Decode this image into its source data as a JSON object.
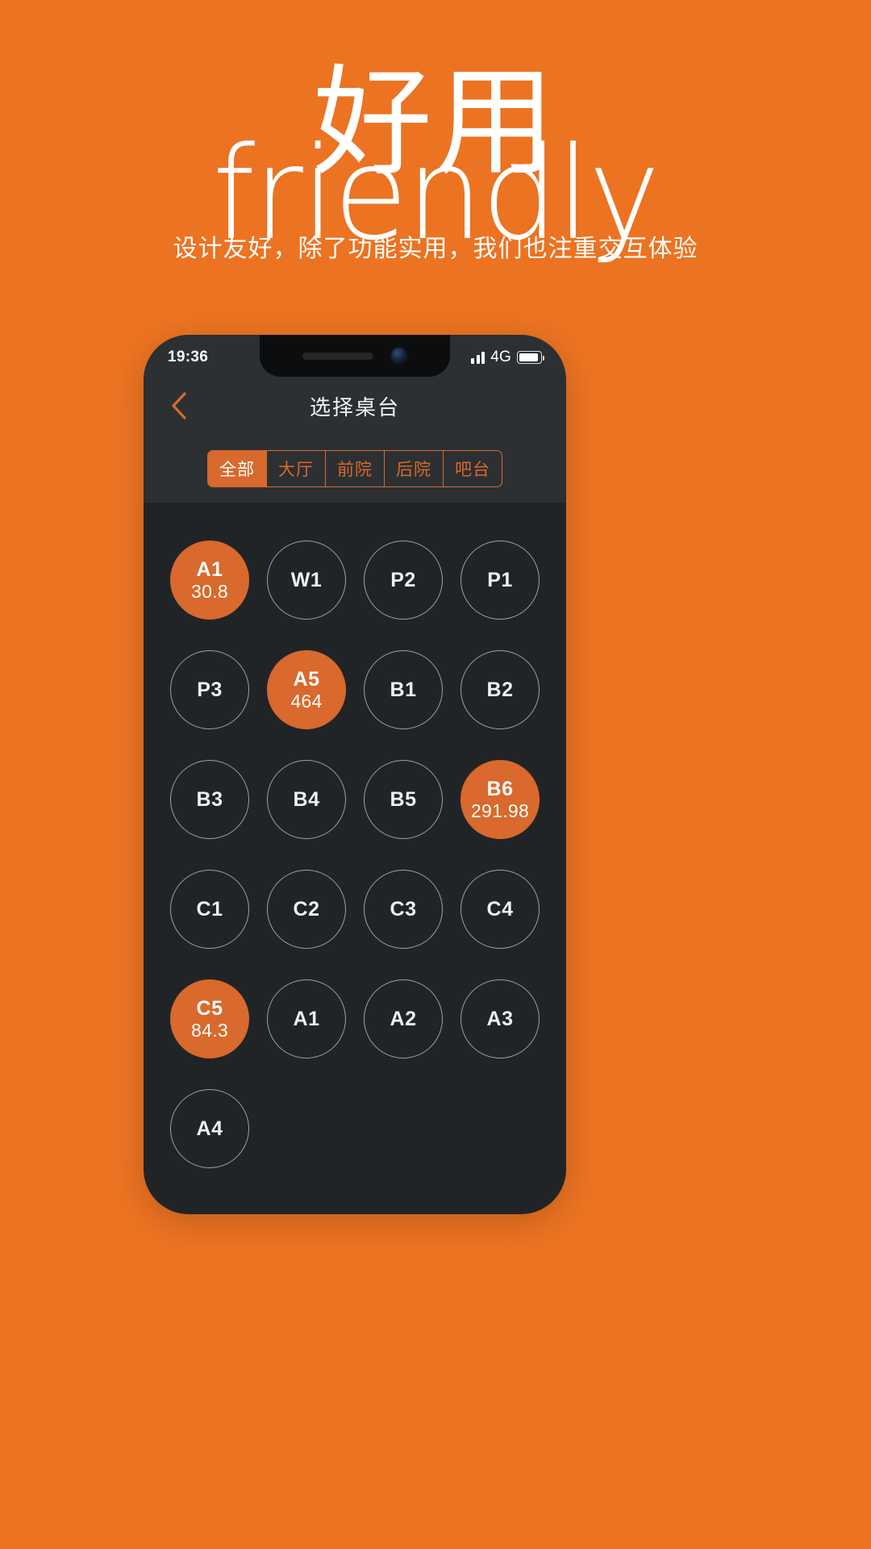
{
  "hero": {
    "headline_cn": "好用",
    "headline_en": "friendly",
    "subtitle": "设计友好，除了功能实用，我们也注重交互体验"
  },
  "colors": {
    "background": "#EC7322",
    "accent": "#D9692C",
    "phone_body": "#2C3033",
    "screen": "#212427",
    "outline": "#9BA0A3"
  },
  "phone": {
    "status_bar": {
      "time": "19:36",
      "network": "4G",
      "signal_icon": "signal-bars-icon",
      "battery_icon": "battery-icon"
    },
    "nav": {
      "back_icon": "chevron-left-icon",
      "title": "选择桌台"
    },
    "tabs": [
      {
        "label": "全部",
        "active": true
      },
      {
        "label": "大厅",
        "active": false
      },
      {
        "label": "前院",
        "active": false
      },
      {
        "label": "后院",
        "active": false
      },
      {
        "label": "吧台",
        "active": false
      }
    ],
    "tables": [
      {
        "name": "A1",
        "amount": "30.8",
        "status": "busy"
      },
      {
        "name": "W1",
        "amount": "",
        "status": "free"
      },
      {
        "name": "P2",
        "amount": "",
        "status": "free"
      },
      {
        "name": "P1",
        "amount": "",
        "status": "free"
      },
      {
        "name": "P3",
        "amount": "",
        "status": "free"
      },
      {
        "name": "A5",
        "amount": "464",
        "status": "busy"
      },
      {
        "name": "B1",
        "amount": "",
        "status": "free"
      },
      {
        "name": "B2",
        "amount": "",
        "status": "free"
      },
      {
        "name": "B3",
        "amount": "",
        "status": "free"
      },
      {
        "name": "B4",
        "amount": "",
        "status": "free"
      },
      {
        "name": "B5",
        "amount": "",
        "status": "free"
      },
      {
        "name": "B6",
        "amount": "291.98",
        "status": "busy"
      },
      {
        "name": "C1",
        "amount": "",
        "status": "free"
      },
      {
        "name": "C2",
        "amount": "",
        "status": "free"
      },
      {
        "name": "C3",
        "amount": "",
        "status": "free"
      },
      {
        "name": "C4",
        "amount": "",
        "status": "free"
      },
      {
        "name": "C5",
        "amount": "84.3",
        "status": "busy"
      },
      {
        "name": "A1",
        "amount": "",
        "status": "free"
      },
      {
        "name": "A2",
        "amount": "",
        "status": "free"
      },
      {
        "name": "A3",
        "amount": "",
        "status": "free"
      },
      {
        "name": "A4",
        "amount": "",
        "status": "free"
      }
    ]
  }
}
